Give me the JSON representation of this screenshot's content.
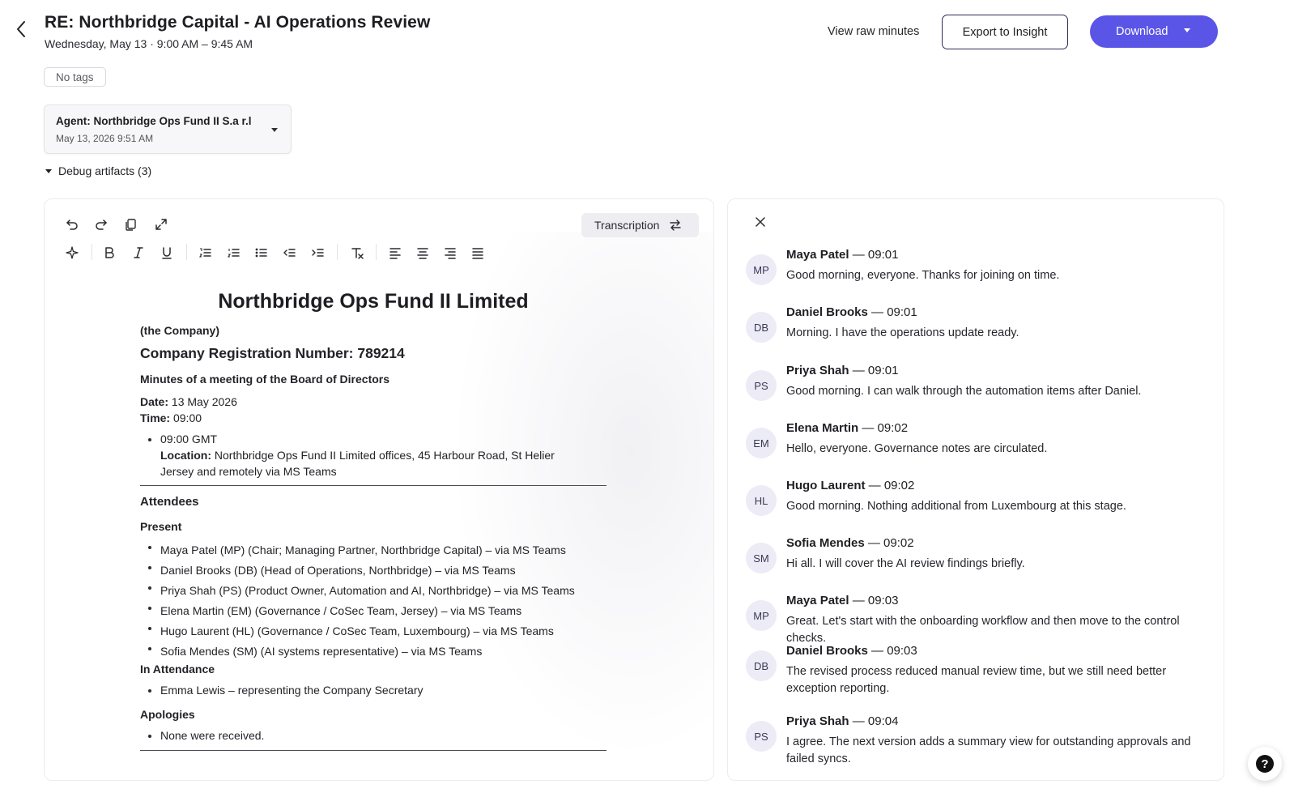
{
  "header": {
    "title": "RE: Northbridge Capital - AI Operations Review",
    "subtitle": "Wednesday, May 13 · 9:00 AM – 9:45 AM",
    "view_raw_label": "View raw minutes",
    "export_label": "Export to Insight",
    "download_label": "Download"
  },
  "tags": {
    "label": "No tags"
  },
  "agent": {
    "title": "Agent: Northbridge Ops Fund II S.a r.l",
    "timestamp": "May 13, 2026 9:51 AM"
  },
  "debug": {
    "label": "Debug artifacts (3)"
  },
  "editor": {
    "transcription_label": "Transcription",
    "toolbar_icons": [
      "undo-icon",
      "redo-icon",
      "copy-icon",
      "expand-icon",
      "sparkle-icon",
      "bold-icon",
      "italic-icon",
      "underline-icon",
      "ordered-list-icon",
      "numbered-list-icon",
      "bullet-list-icon",
      "outdent-icon",
      "indent-icon",
      "clear-format-icon",
      "align-left-icon",
      "align-center-icon",
      "align-right-icon",
      "align-justify-icon"
    ]
  },
  "doc": {
    "heading": "Northbridge Ops Fund II Limited",
    "company_note": "(the Company)",
    "reg_number": "Company Registration Number: 789214",
    "minutes_title": "Minutes of a meeting of the Board of Directors",
    "date_label": "Date:",
    "date_value": " 13 May 2026",
    "time_label": "Time:",
    "time_value": " 09:00",
    "bullet_time": "09:00 GMT",
    "location_label": "Location:",
    "location_value": " Northbridge Ops Fund II Limited offices, 45 Harbour Road, St Helier",
    "location_value_2": "Jersey and remotely via MS Teams",
    "attendees_heading": "Attendees",
    "present_heading": "Present",
    "present": [
      "Maya Patel (MP) (Chair; Managing Partner, Northbridge Capital) – via MS Teams",
      "Daniel Brooks (DB) (Head of Operations, Northbridge) – via MS Teams",
      "Priya Shah (PS) (Product Owner, Automation and AI, Northbridge) – via MS Teams",
      "Elena Martin (EM) (Governance / CoSec Team, Jersey) – via MS Teams",
      "Hugo Laurent (HL) (Governance / CoSec Team, Luxembourg) – via MS Teams",
      "Sofia Mendes (SM) (AI systems representative) – via MS Teams"
    ],
    "in_attendance_heading": "In Attendance",
    "in_attendance": [
      "Emma Lewis – representing the Company Secretary"
    ],
    "apologies_heading": "Apologies",
    "apologies": [
      "None were received."
    ]
  },
  "transcript": [
    {
      "initials": "MP",
      "name": "Maya Patel",
      "time": " — 09:01",
      "text": "Good morning, everyone. Thanks for joining on time."
    },
    {
      "initials": "DB",
      "name": "Daniel Brooks",
      "time": " — 09:01",
      "text": "Morning. I have the operations update ready."
    },
    {
      "initials": "PS",
      "name": "Priya Shah",
      "time": " — 09:01",
      "text": "Good morning. I can walk through the automation items after Daniel."
    },
    {
      "initials": "EM",
      "name": "Elena Martin",
      "time": " — 09:02",
      "text": "Hello, everyone. Governance notes are circulated."
    },
    {
      "initials": "HL",
      "name": "Hugo Laurent",
      "time": " — 09:02",
      "text": "Good morning. Nothing additional from Luxembourg at this stage."
    },
    {
      "initials": "SM",
      "name": "Sofia Mendes",
      "time": " — 09:02",
      "text": "Hi all. I will cover the AI review findings briefly."
    },
    {
      "initials": "MP",
      "name": "Maya Patel",
      "time": " — 09:03",
      "text": "Great. Let's start with the onboarding workflow and then move to the control checks."
    },
    {
      "initials": "DB",
      "name": "Daniel Brooks",
      "time": " — 09:03",
      "text": "The revised process reduced manual review time, but we still need better exception reporting."
    },
    {
      "initials": "PS",
      "name": "Priya Shah",
      "time": " — 09:04",
      "text": "I agree. The next version adds a summary view for outstanding approvals and failed syncs."
    }
  ],
  "help": {
    "label": "?"
  }
}
